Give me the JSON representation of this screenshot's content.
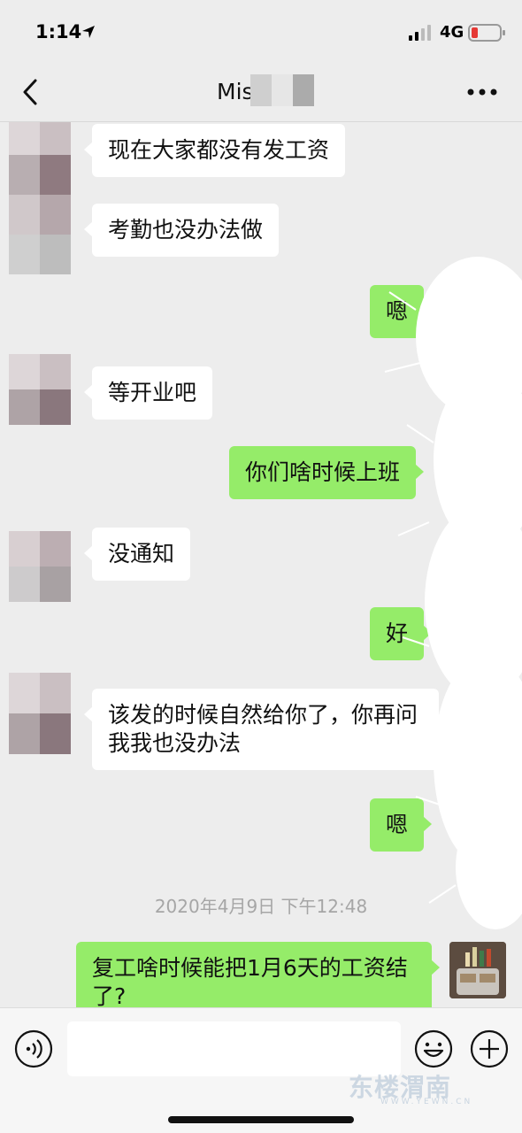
{
  "status_bar": {
    "time": "1:14",
    "network": "4G",
    "icons": [
      "location-arrow-icon",
      "signal-bars-icon",
      "battery-low-icon"
    ]
  },
  "nav": {
    "back_icon": "chevron-left-icon",
    "title": "Mis",
    "more_icon": "more-dots-icon"
  },
  "messages": [
    {
      "side": "in",
      "text": "现在大家都没有发工资"
    },
    {
      "side": "in",
      "text": "考勤也没办法做"
    },
    {
      "side": "out",
      "text": "嗯"
    },
    {
      "side": "in",
      "text": "等开业吧"
    },
    {
      "side": "out",
      "text": "你们啥时候上班"
    },
    {
      "side": "in",
      "text": "没通知"
    },
    {
      "side": "out",
      "text": "好"
    },
    {
      "side": "in",
      "text": "该发的时候自然给你了，你再问我我也没办法"
    },
    {
      "side": "out",
      "text": "嗯"
    },
    {
      "side": "out",
      "text": "复工啥时候能把1月6天的工资结了?"
    }
  ],
  "timestamp": "2020年4月9日 下午12:48",
  "input_bar": {
    "voice_icon": "voice-icon",
    "placeholder": "",
    "emoji_icon": "emoji-icon",
    "plus_icon": "plus-icon",
    "watermark": "东楼渭南",
    "watermark_sub": "WWW.YEWN.CN"
  },
  "colors": {
    "background": "#ededed",
    "incoming_bubble": "#ffffff",
    "outgoing_bubble": "#95ec69",
    "timestamp": "#a6a6a6"
  }
}
